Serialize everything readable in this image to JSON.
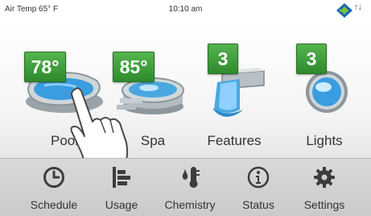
{
  "status_bar": {
    "air_temp": "Air Temp 65° F",
    "time": "10:10 am",
    "network": "↑↓"
  },
  "tiles": [
    {
      "label": "Pool",
      "badge": "78°",
      "icon": "pool-icon"
    },
    {
      "label": "Spa",
      "badge": "85°",
      "icon": "spa-icon"
    },
    {
      "label": "Features",
      "badge": "3",
      "icon": "waterfall-icon"
    },
    {
      "label": "Lights",
      "badge": "3",
      "icon": "light-icon"
    }
  ],
  "toolbar": [
    {
      "label": "Schedule",
      "icon": "clock-icon"
    },
    {
      "label": "Usage",
      "icon": "bar-chart-icon"
    },
    {
      "label": "Chemistry",
      "icon": "thermometer-drop-icon"
    },
    {
      "label": "Status",
      "icon": "info-icon"
    },
    {
      "label": "Settings",
      "icon": "gear-icon"
    }
  ],
  "colors": {
    "badge_green": "#3f9e3c",
    "toolbar_bg": "#d2d2d2",
    "icon_dark": "#3d3d3d",
    "water_blue": "#4aa8e0"
  }
}
